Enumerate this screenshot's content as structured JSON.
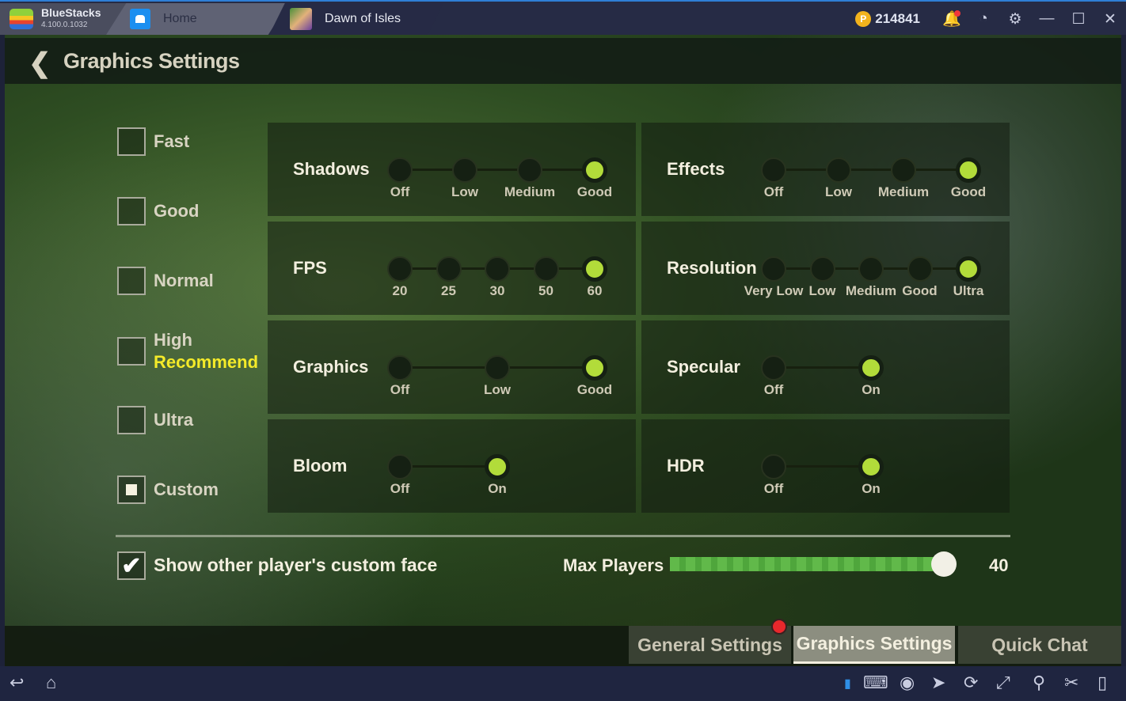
{
  "titlebar": {
    "app_name": "BlueStacks",
    "version": "4.100.0.1032",
    "tabs": [
      {
        "label": "Home"
      },
      {
        "label": "Dawn of Isles"
      }
    ],
    "coins": "214841",
    "icons": [
      "bell-icon",
      "account-star-icon",
      "gear-icon",
      "minimize-icon",
      "maximize-icon",
      "close-icon"
    ]
  },
  "header": {
    "title": "Graphics Settings"
  },
  "presets": [
    {
      "label": "Fast",
      "checked": false
    },
    {
      "label": "Good",
      "checked": false
    },
    {
      "label": "Normal",
      "checked": false
    },
    {
      "label": "High",
      "sub": "Recommend",
      "checked": false
    },
    {
      "label": "Ultra",
      "checked": false
    },
    {
      "label": "Custom",
      "checked": true
    }
  ],
  "options": [
    {
      "label": "Shadows",
      "choices": [
        "Off",
        "Low",
        "Medium",
        "Good"
      ],
      "selected": 3
    },
    {
      "label": "Effects",
      "choices": [
        "Off",
        "Low",
        "Medium",
        "Good"
      ],
      "selected": 3
    },
    {
      "label": "FPS",
      "choices": [
        "20",
        "25",
        "30",
        "50",
        "60"
      ],
      "selected": 4
    },
    {
      "label": "Resolution",
      "choices": [
        "Very Low",
        "Low",
        "Medium",
        "Good",
        "Ultra"
      ],
      "selected": 4
    },
    {
      "label": "Graphics",
      "choices": [
        "Off",
        "Low",
        "Good"
      ],
      "selected": 2
    },
    {
      "label": "Specular",
      "choices": [
        "Off",
        "On"
      ],
      "selected": 1
    },
    {
      "label": "Bloom",
      "choices": [
        "Off",
        "On"
      ],
      "selected": 1
    },
    {
      "label": "HDR",
      "choices": [
        "Off",
        "On"
      ],
      "selected": 1
    }
  ],
  "face": {
    "label": "Show other player's custom face",
    "checked": true
  },
  "max_players": {
    "label": "Max Players",
    "value": "40",
    "fill_fraction": 1.0
  },
  "bottom_tabs": [
    {
      "label": "General Settings",
      "badge": true
    },
    {
      "label": "Graphics Settings",
      "active": true
    },
    {
      "label": "Quick Chat"
    }
  ],
  "colors": {
    "accent": "#b2dc3a",
    "recommend": "#f4ea29",
    "slider": "#61b94a"
  }
}
